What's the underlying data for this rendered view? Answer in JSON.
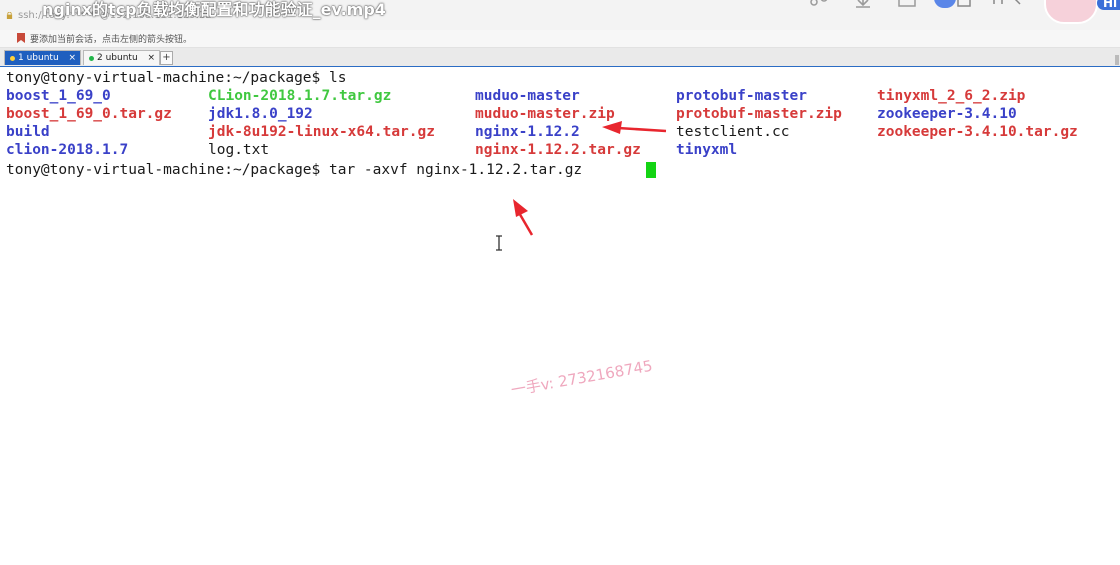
{
  "video": {
    "title": "nginx的tcp负载均衡配置和功能验证_ev.mp4",
    "hi_label": "Hi"
  },
  "window": {
    "ssh_address": "ssh://tony:******@192.168.131.129:22"
  },
  "hint": {
    "text": "要添加当前会话，点击左侧的箭头按钮。"
  },
  "tabs": [
    {
      "label": "1 ubuntu",
      "close": "×"
    },
    {
      "label": "2 ubuntu",
      "close": "×"
    }
  ],
  "tab_add_label": "+",
  "terminal": {
    "prompt_line_1": "tony@tony-virtual-machine:~/package$ ls",
    "prompt_line_2": "tony@tony-virtual-machine:~/package$ tar -axvf nginx-1.12.2.tar.gz ",
    "listing": [
      [
        "boost_1_69_0",
        "CLion-2018.1.7.tar.gz",
        "muduo-master",
        "protobuf-master",
        "tinyxml_2_6_2.zip"
      ],
      [
        "boost_1_69_0.tar.gz",
        "jdk1.8.0_192",
        "muduo-master.zip",
        "protobuf-master.zip",
        "zookeeper-3.4.10"
      ],
      [
        "build",
        "jdk-8u192-linux-x64.tar.gz",
        "nginx-1.12.2",
        "testclient.cc",
        "zookeeper-3.4.10.tar.gz"
      ],
      [
        "clion-2018.1.7",
        "log.txt",
        "nginx-1.12.2.tar.gz",
        "tinyxml",
        ""
      ]
    ]
  },
  "watermark": {
    "text": "一手v: 2732168745"
  },
  "colors": {
    "directory": "#3a41c8",
    "archive": "#d63a3a",
    "executable": "#40c840",
    "regular_file": "#1a1a1a",
    "cursor": "#13d413",
    "annotation_arrow": "#e8262e",
    "active_tab": "#1f5fbf"
  }
}
